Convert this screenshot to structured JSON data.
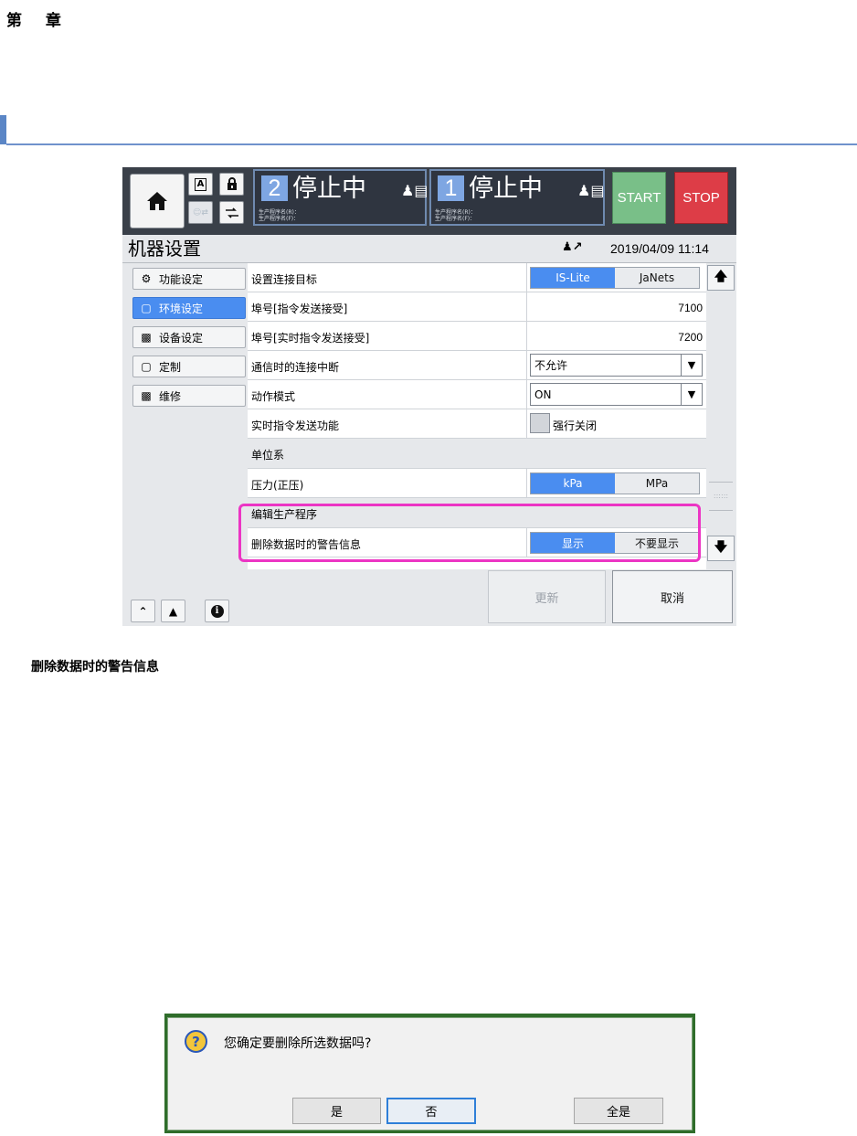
{
  "doc": {
    "chapter": "第 章",
    "caption": "删除数据时的警告信息"
  },
  "topbar": {
    "panels": [
      {
        "number": "2",
        "status": "停止中",
        "line1": "生产程序名(R)：",
        "line2": "生产程序名(F)："
      },
      {
        "number": "1",
        "status": "停止中",
        "line1": "生产程序名(R)：",
        "line2": "生产程序名(F)："
      }
    ],
    "start_label": "START",
    "stop_label": "STOP",
    "lock_badge": "A"
  },
  "header": {
    "title": "机器设置",
    "datetime": "2019/04/09 11:14"
  },
  "sidebar": {
    "items": [
      {
        "label": "功能设定",
        "icon": "function-settings-icon",
        "active": false
      },
      {
        "label": "环境设定",
        "icon": "environment-settings-icon",
        "active": true
      },
      {
        "label": "设备设定",
        "icon": "device-settings-icon",
        "active": false
      },
      {
        "label": "定制",
        "icon": "customize-icon",
        "active": false
      },
      {
        "label": "维修",
        "icon": "maintenance-icon",
        "active": false
      }
    ]
  },
  "settings": {
    "connection_target": {
      "label": "设置连接目标",
      "options": [
        "IS-Lite",
        "JaNets"
      ],
      "selected": "IS-Lite"
    },
    "port_command": {
      "label": "埠号[指令发送接受]",
      "value": "7100"
    },
    "port_realtime": {
      "label": "埠号[实时指令发送接受]",
      "value": "7200"
    },
    "comm_disconnect": {
      "label": "通信时的连接中断",
      "value": "不允许"
    },
    "action_mode": {
      "label": "动作模式",
      "value": "ON"
    },
    "realtime_send": {
      "label": "实时指令发送功能",
      "checkbox_label": "强行关闭"
    },
    "unit_section": "单位系",
    "pressure": {
      "label": "压力(正压)",
      "options": [
        "kPa",
        "MPa"
      ],
      "selected": "kPa"
    },
    "edit_section": "编辑生产程序",
    "delete_warning": {
      "label": "删除数据时的警告信息",
      "options": [
        "显示",
        "不要显示"
      ],
      "selected": "显示"
    }
  },
  "actions": {
    "update_label": "更新",
    "cancel_label": "取消"
  },
  "dialog": {
    "message": "您确定要删除所选数据吗?",
    "yes_label": "是",
    "no_label": "否",
    "all_yes_label": "全是",
    "icon_glyph": "?"
  },
  "colors": {
    "accent": "#4a8df0",
    "highlight": "#ec35c4",
    "start": "#79bf88",
    "stop": "#dd3d47"
  }
}
